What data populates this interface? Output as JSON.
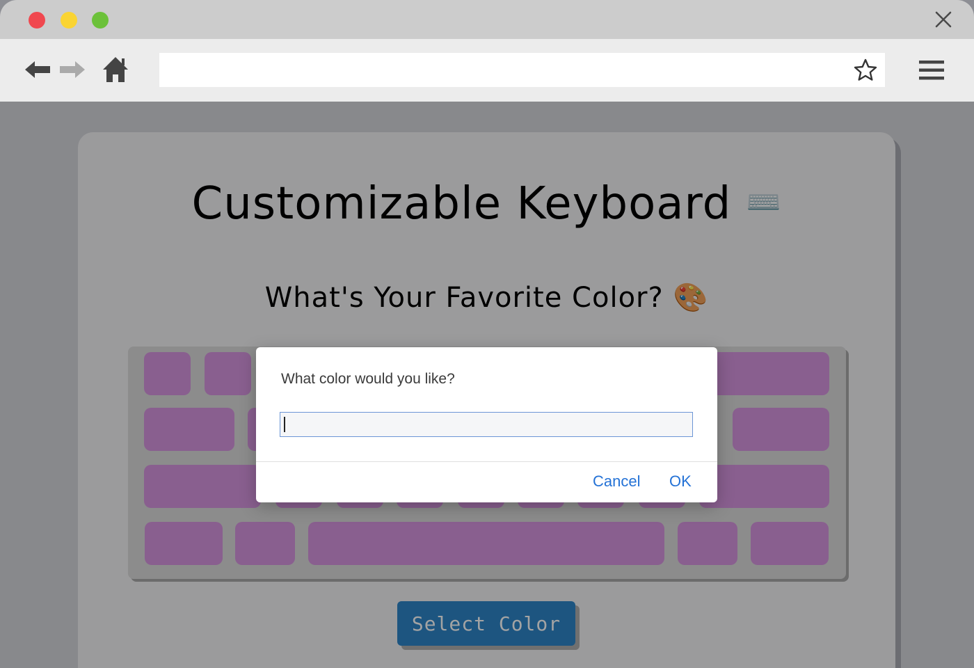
{
  "browser": {
    "url": "",
    "icons": {
      "back": "arrow-left-icon",
      "forward": "arrow-right-icon",
      "home": "home-icon",
      "bookmark": "star-icon",
      "menu": "hamburger-menu-icon",
      "close": "close-icon"
    }
  },
  "page": {
    "title": "Customizable Keyboard",
    "title_emoji": "⌨️",
    "subtitle": "What's Your Favorite Color?",
    "subtitle_emoji": "🎨",
    "select_button_label": "Select Color",
    "key_color": "#d795e0",
    "button_color": "#2e86c9"
  },
  "dialog": {
    "message": "What color would you like?",
    "input_value": "",
    "cancel_label": "Cancel",
    "ok_label": "OK",
    "accent_color": "#2472d6"
  }
}
